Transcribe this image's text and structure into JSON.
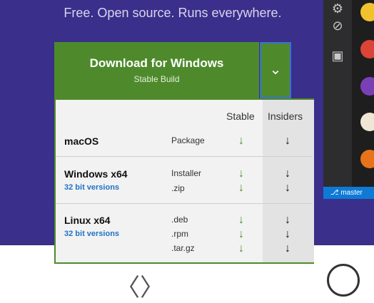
{
  "hero": {
    "tagline": "Free. Open source. Runs everywhere."
  },
  "download": {
    "title": "Download for Windows",
    "subtitle": "Stable Build",
    "toggle_glyph": "⌄"
  },
  "table": {
    "headers": {
      "stable": "Stable",
      "insiders": "Insiders"
    },
    "arrow_glyph": "↓",
    "rows": [
      {
        "os": "macOS",
        "sub": "",
        "packages": [
          "Package"
        ]
      },
      {
        "os": "Windows x64",
        "sub": "32 bit versions",
        "packages": [
          "Installer",
          ".zip"
        ]
      },
      {
        "os": "Linux x64",
        "sub": "32 bit versions",
        "packages": [
          ".deb",
          ".rpm",
          ".tar.gz"
        ]
      }
    ]
  },
  "editor": {
    "branch": "master"
  },
  "nav": {
    "prev": "〈",
    "next": "〉"
  },
  "icons": [
    "gear-icon",
    "debug-icon",
    "extensions-icon",
    "chrome-icon",
    "vscode-icon",
    "paint-icon",
    "app-icon",
    "no-bugs-icon"
  ],
  "colors": {
    "hero": "#3a2f8a",
    "download_green": "#4e8a2c",
    "link_blue": "#1f73c6",
    "status_blue": "#0e7ad6"
  }
}
